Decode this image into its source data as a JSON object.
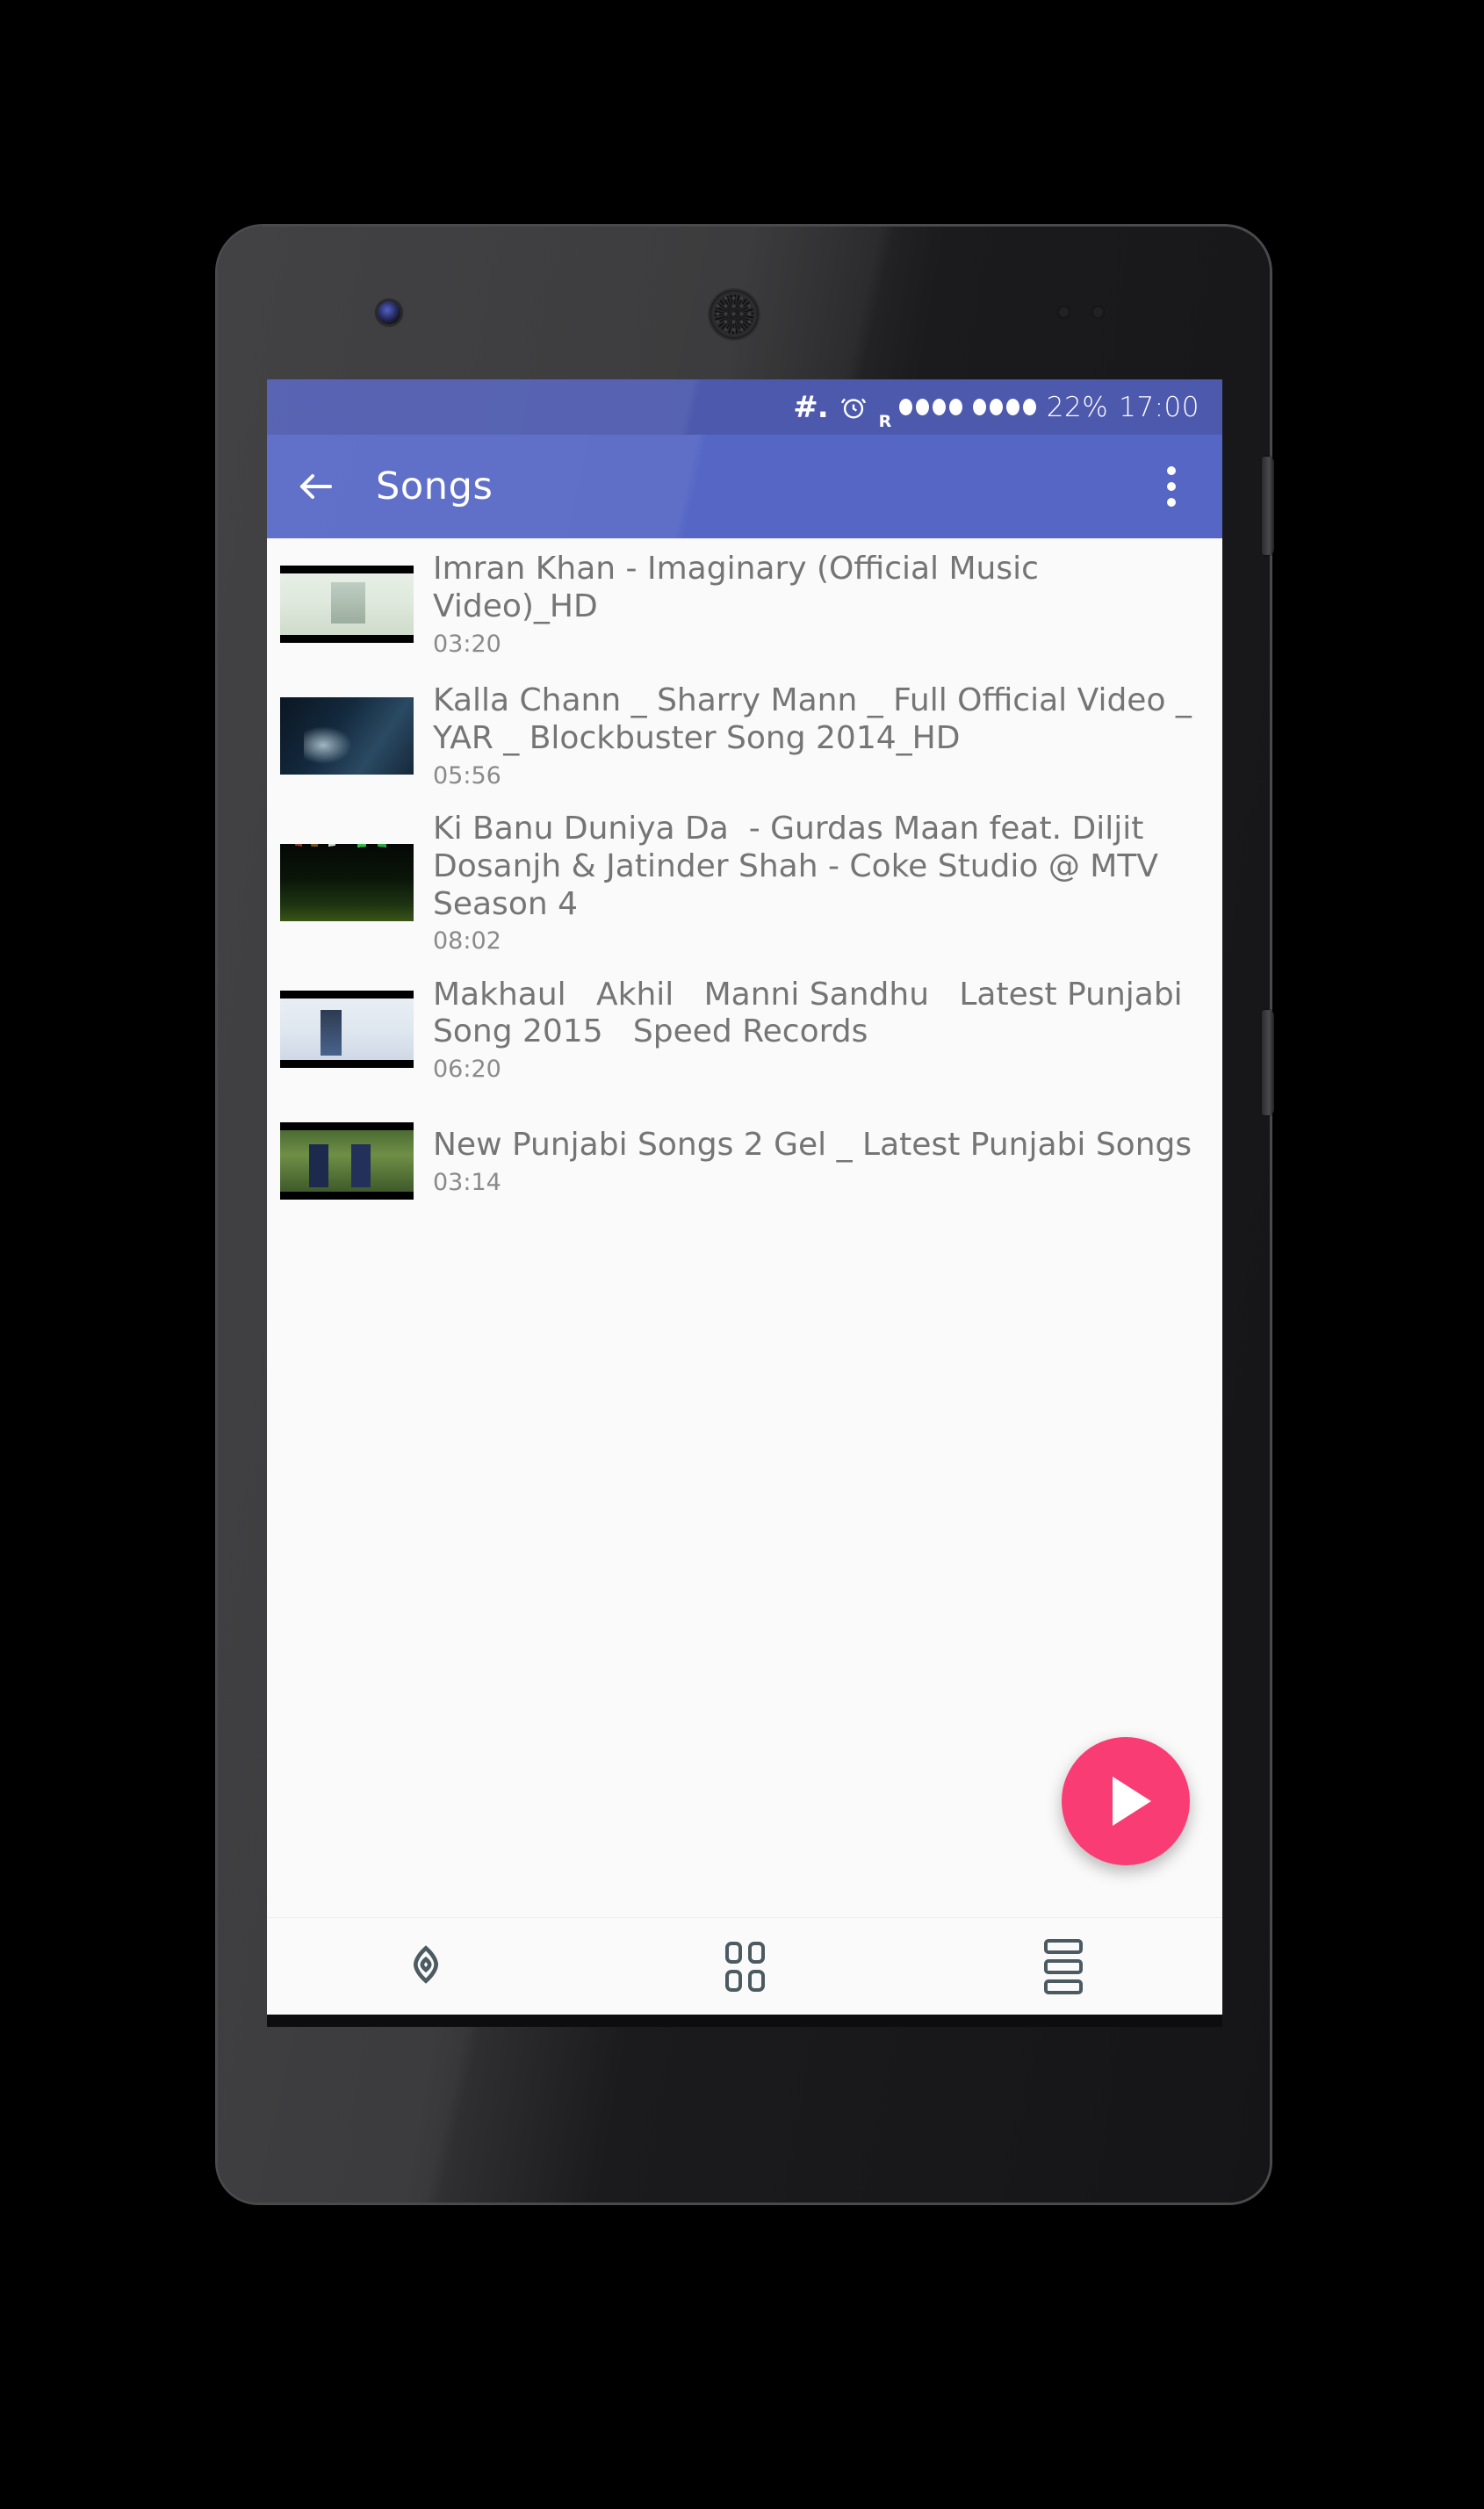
{
  "device": {
    "name": "android-phone-mockup"
  },
  "statusbar": {
    "hash_icon": "hash-icon",
    "alarm_icon": "alarm-clock-icon",
    "roaming_label": "R",
    "signal1_icon": "signal-bars-icon",
    "signal2_icon": "signal-bars-icon",
    "battery": "22%",
    "time": "17:00",
    "bg_color": "#4c59ad"
  },
  "appbar": {
    "back_icon": "back-arrow-icon",
    "title": "Songs",
    "overflow_icon": "overflow-menu-icon",
    "bg_color": "#5566c5"
  },
  "list": {
    "items": [
      {
        "title": "Imran Khan - Imaginary (Official Music Video)_HD",
        "duration": "03:20",
        "thumb": "thumbnail-imran-khan"
      },
      {
        "title": "Kalla Chann _ Sharry Mann _ Full Official Video _ YAR _ Blockbuster Song 2014_HD",
        "duration": "05:56",
        "thumb": "thumbnail-kalla-chann"
      },
      {
        "title": "Ki Banu Duniya Da  - Gurdas Maan feat. Diljit Dosanjh & Jatinder Shah - Coke Studio @ MTV Season 4",
        "duration": "08:02",
        "thumb": "thumbnail-ki-banu-duniya-da"
      },
      {
        "title": "Makhaul   Akhil   Manni Sandhu   Latest Punjabi Song 2015   Speed Records",
        "duration": "06:20",
        "thumb": "thumbnail-makhaul"
      },
      {
        "title": "New Punjabi Songs 2 Gel _ Latest Punjabi Songs",
        "duration": "03:14",
        "thumb": "thumbnail-new-punjabi-songs"
      }
    ]
  },
  "fab": {
    "icon": "play-icon",
    "color": "#f93d74"
  },
  "bottomnav": {
    "items": [
      {
        "icon": "eye-icon"
      },
      {
        "icon": "grid-view-icon"
      },
      {
        "icon": "list-view-icon"
      }
    ]
  },
  "colors": {
    "accent_pink": "#f93d74",
    "appbar_indigo": "#5566c5",
    "statusbar_indigo": "#4c59ad",
    "content_bg": "#fafafa",
    "text_grey": "#757575"
  }
}
